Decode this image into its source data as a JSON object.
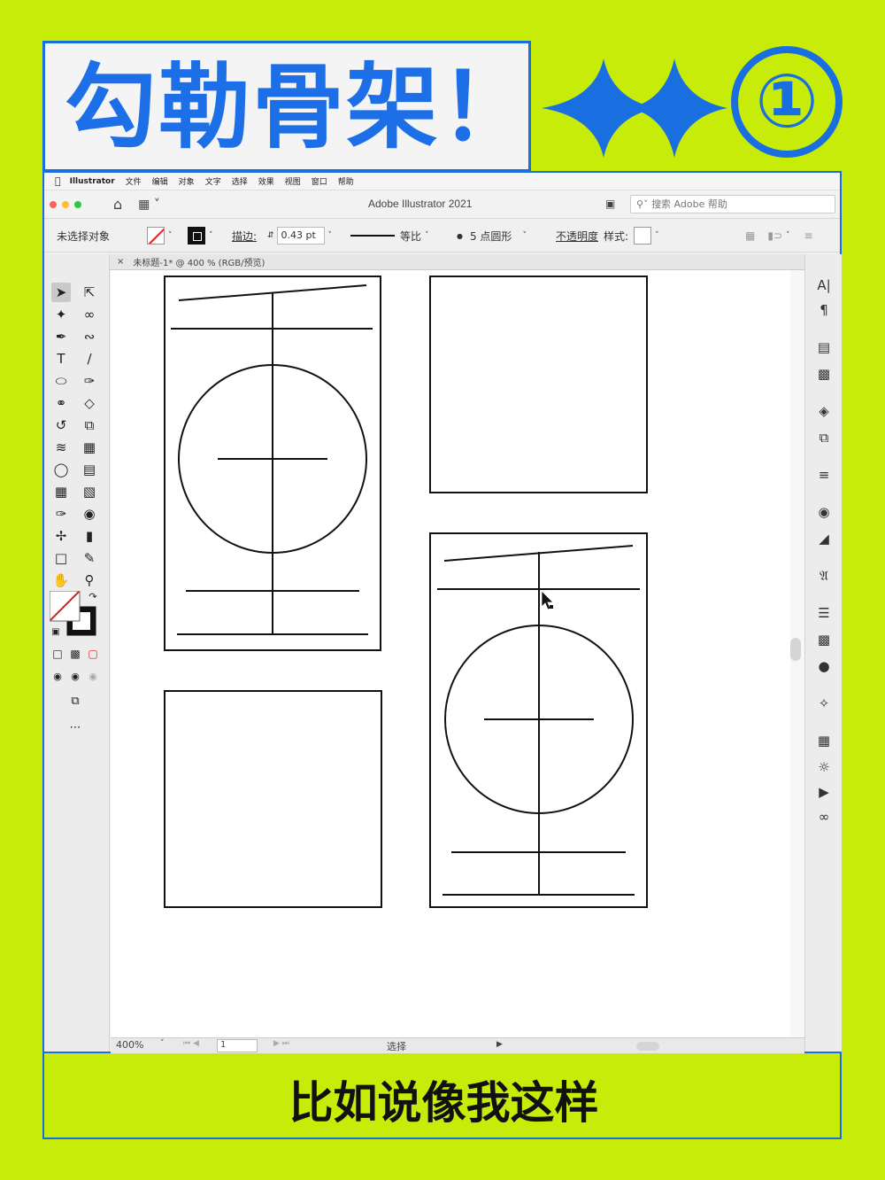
{
  "banner": {
    "title": "勾勒骨架！",
    "badge_number": "①",
    "accent": "#1a6fe0",
    "background": "#c8ec0a"
  },
  "menubar": {
    "apple_icon": "apple-icon",
    "items": [
      "Illustrator",
      "文件",
      "编辑",
      "对象",
      "文字",
      "选择",
      "效果",
      "视图",
      "窗口",
      "帮助"
    ]
  },
  "window": {
    "title": "Adobe Illustrator 2021",
    "search_placeholder": "搜索 Adobe 帮助"
  },
  "control_bar": {
    "selection_label": "未选择对象",
    "stroke_label": "描边:",
    "stroke_weight": "0.43 pt",
    "profile_label": "等比",
    "brush_label": "5 点圆形",
    "opacity_label": "不透明度",
    "style_label": "样式:"
  },
  "document_tab": {
    "close": "×",
    "label": "未标题-1* @ 400 % (RGB/预览)"
  },
  "status_bar": {
    "zoom": "400%",
    "page": "1",
    "mode": "选择"
  },
  "caption": "比如说像我这样"
}
